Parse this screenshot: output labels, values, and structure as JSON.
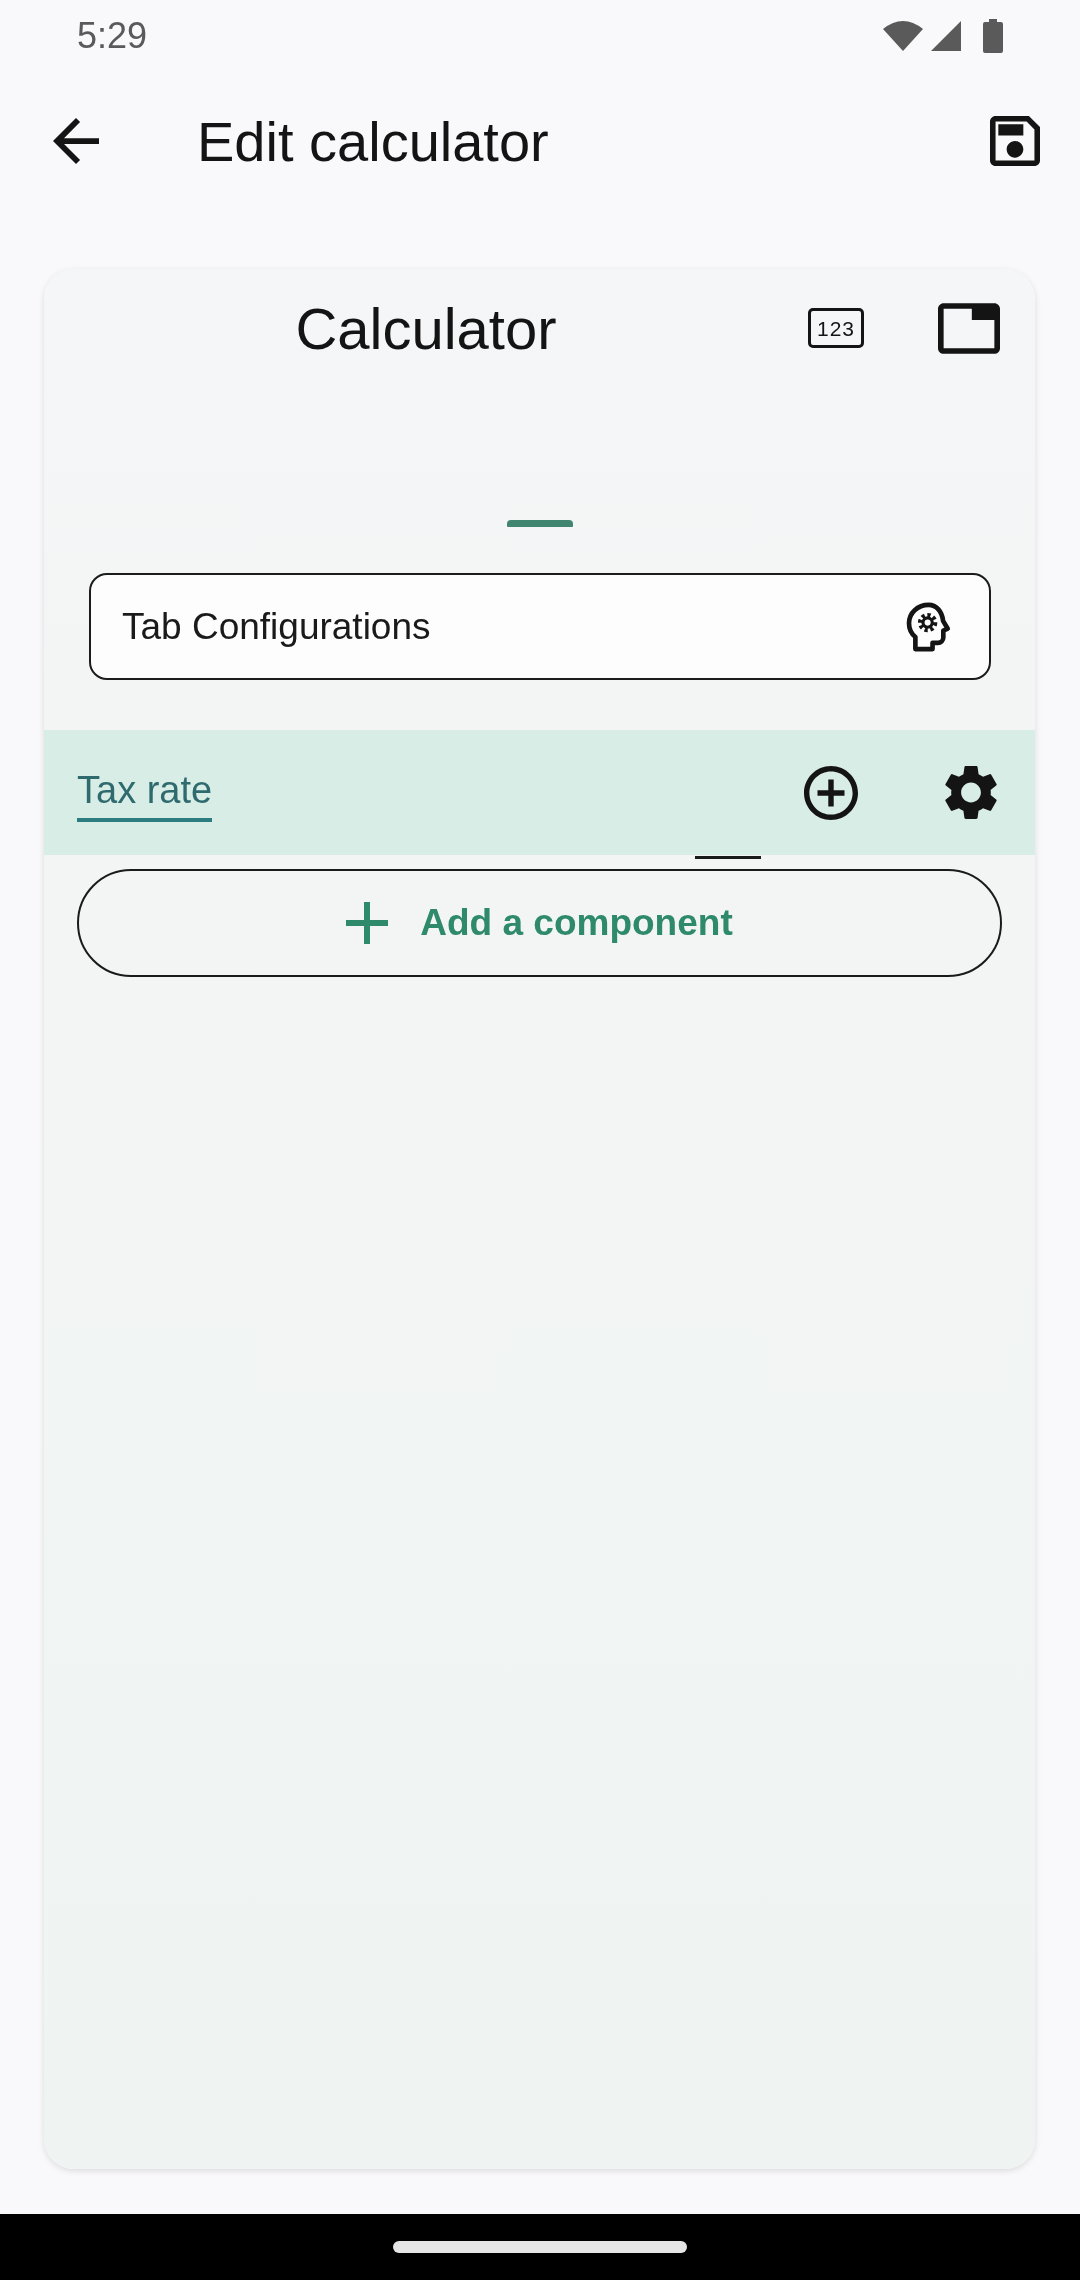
{
  "status_bar": {
    "time": "5:29"
  },
  "app_bar": {
    "title": "Edit calculator"
  },
  "card": {
    "title": "Calculator",
    "numbers_button": "123"
  },
  "config_field": {
    "value": "Tab Configurations"
  },
  "tabs": [
    {
      "label": "Tax rate",
      "selected": true
    }
  ],
  "add_button": {
    "label": "Add a component"
  }
}
